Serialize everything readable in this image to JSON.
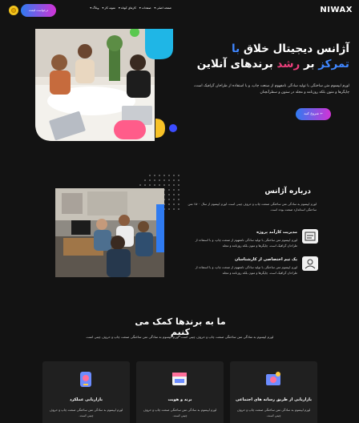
{
  "header": {
    "logo": "NIWAX",
    "nav": [
      "صفحه اصلی ▾",
      "صفحات ▾",
      "کارهای کوتاه ▾",
      "نمونه کار ▾",
      "وبلاگ ▾"
    ],
    "cta": "درخواست قیمت"
  },
  "hero": {
    "title_line1_a": "آژانس دیجیتال خلاق ",
    "title_line1_b": "با",
    "title_line2_a": "تمرکز",
    "title_line2_b": " بر ",
    "title_line2_c": "رشد",
    "title_line2_d": " برندهای آنلاین",
    "text": "لورم ایپسوم متن ساختگی با تولید سادگی نامفهوم از صنعت چاپ، و با استفاده از طراحان گرافیک است، چاپگرها و متون بلکه روزنامه و مجله در ستون و سطرآنچنان",
    "button": "شروع کنید ←"
  },
  "about": {
    "title": "درباره آژانس",
    "text": "لورم ایپسوم به سادگی متن ساختگی صنعت چاپ و حروف چینی است. لورم ایپسوم از سال ۱۵۰۰ متن ساختگی استاندارد صنعت بوده است.",
    "features": [
      {
        "title": "مدیریت کارآمد پروژه",
        "text": "لورم ایپسوم متن ساختگی با تولید سادگی نامفهوم از صنعت چاپ، و با استفاده از طراحان گرافیک است، چاپگرها و متون بلکه روزنامه و مجله"
      },
      {
        "title": "یک تیم اختصاصی از کارشناسان",
        "text": "لورم ایپسوم متن ساختگی با تولید سادگی نامفهوم از صنعت چاپ، و با استفاده از طراحان گرافیک است، چاپگرها و متون بلکه روزنامه و مجله"
      }
    ]
  },
  "help": {
    "title": "ما به برندها کمک می کنیم",
    "text": "لورم ایپسوم به سادگی متن ساختگی صنعت چاپ و حروف چینی است. لورم ایپسوم به سادگی متن ساختگی صنعت چاپ و حروف چینی است.",
    "cards": [
      {
        "title": "بازاریابی از طریق رسانه های اجتماعی",
        "text": "لورم ایپسوم به سادگی متن ساختگی صنعت چاپ و حروف چینی است."
      },
      {
        "title": "برند و هویت",
        "text": "لورم ایپسوم به سادگی متن ساختگی صنعت چاپ و حروف چینی است."
      },
      {
        "title": "بازاریابی عملکرد",
        "text": "لورم ایپسوم به سادگی متن ساختگی صنعت چاپ و حروف چینی است."
      }
    ]
  },
  "colors": {
    "accent_blue": "#3f86ff",
    "accent_pink": "#ec3f7c",
    "gradient_start": "#2f7bf1",
    "gradient_end": "#d233d6",
    "background": "#131313"
  }
}
